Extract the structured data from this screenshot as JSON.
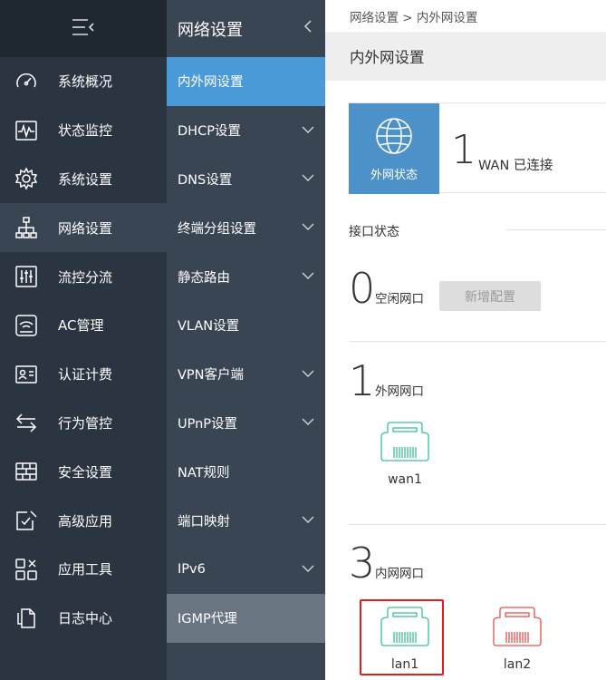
{
  "sidebar": {
    "toggle_icon": "menu-collapse-icon",
    "items": [
      {
        "label": "系统概况",
        "icon": "dashboard-icon"
      },
      {
        "label": "状态监控",
        "icon": "pulse-monitor-icon"
      },
      {
        "label": "系统设置",
        "icon": "gear-icon"
      },
      {
        "label": "网络设置",
        "icon": "network-topology-icon",
        "active": true
      },
      {
        "label": "流控分流",
        "icon": "equalizer-icon"
      },
      {
        "label": "AC管理",
        "icon": "wifi-router-icon"
      },
      {
        "label": "认证计费",
        "icon": "id-card-icon"
      },
      {
        "label": "行为管控",
        "icon": "swap-arrows-icon"
      },
      {
        "label": "安全设置",
        "icon": "firewall-icon"
      },
      {
        "label": "高级应用",
        "icon": "edit-document-icon"
      },
      {
        "label": "应用工具",
        "icon": "tools-grid-icon"
      },
      {
        "label": "日志中心",
        "icon": "log-document-icon"
      }
    ]
  },
  "submenu": {
    "title": "网络设置",
    "items": [
      {
        "label": "内外网设置",
        "expandable": false,
        "state": "active"
      },
      {
        "label": "DHCP设置",
        "expandable": true
      },
      {
        "label": "DNS设置",
        "expandable": true
      },
      {
        "label": "终端分组设置",
        "expandable": true
      },
      {
        "label": "静态路由",
        "expandable": true
      },
      {
        "label": "VLAN设置",
        "expandable": false
      },
      {
        "label": "VPN客户端",
        "expandable": true
      },
      {
        "label": "UPnP设置",
        "expandable": true
      },
      {
        "label": "NAT规则",
        "expandable": false
      },
      {
        "label": "端口映射",
        "expandable": true
      },
      {
        "label": "IPv6",
        "expandable": true
      },
      {
        "label": "IGMP代理",
        "expandable": false,
        "state": "muted"
      }
    ]
  },
  "main": {
    "breadcrumb": "网络设置 > 内外网设置",
    "page_title": "内外网设置",
    "wan_card": {
      "badge_label": "外网状态",
      "count": "1",
      "status_text": "WAN 已连接"
    },
    "interface_status_heading": "接口状态",
    "idle": {
      "count": "0",
      "label": "空闲网口",
      "add_button": "新增配置"
    },
    "wan_group": {
      "count": "1",
      "label": "外网网口",
      "ports": [
        {
          "name": "wan1"
        }
      ]
    },
    "lan_group": {
      "count": "3",
      "label": "内网网口",
      "ports": [
        {
          "name": "lan1",
          "selected": true
        },
        {
          "name": "lan2"
        }
      ]
    }
  },
  "colors": {
    "sidebar_bg": "#2b3441",
    "submenu_bg": "#3a4554",
    "active_blue": "#4b9ad8",
    "badge_blue": "#4d91c9",
    "port_green": "#3dbf95",
    "port_red": "#e8524f",
    "highlight_red": "#e02020"
  }
}
